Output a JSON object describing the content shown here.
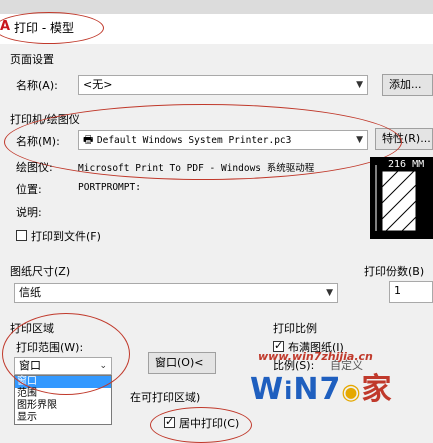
{
  "window": {
    "title": "打印 - 模型"
  },
  "page_setup": {
    "section": "页面设置",
    "name_label": "名称(A):",
    "name_value": "<无>",
    "add_button": "添加..."
  },
  "printer": {
    "section": "打印机/绘图仪",
    "name_label": "名称(M):",
    "name_value": "Default Windows System Printer.pc3",
    "properties_button": "特性(R)...",
    "plotter_label": "绘图仪:",
    "plotter_value": "Microsoft Print To PDF - Windows 系统驱动程",
    "location_label": "位置:",
    "location_value": "PORTPROMPT:",
    "description_label": "说明:",
    "print_to_file": "打印到文件(F)",
    "preview_dimension": "216 MM"
  },
  "paper_size": {
    "section": "图纸尺寸(Z)",
    "value": "信纸"
  },
  "copies": {
    "label": "打印份数(B)",
    "value": "1"
  },
  "print_area": {
    "section": "打印区域",
    "range_label": "打印范围(W):",
    "range_value": "窗口",
    "options": [
      "窗口",
      "范围",
      "图形界限",
      "显示"
    ],
    "window_button": "窗口(O)<",
    "offset_label_partial": "在可打印区域)"
  },
  "scale": {
    "section": "打印比例",
    "fit_paper": "布满图纸(I)",
    "scale_label": "比例(S):",
    "scale_value": "自定义"
  },
  "offset": {
    "center_print": "居中打印(C)"
  },
  "watermark": {
    "url": "www.win7zhijia.cn",
    "brand_left": "W",
    "brand_mid": "N",
    "brand_num": "7",
    "brand_zh": "家"
  },
  "colors": {
    "annotation_red": "#c0392b",
    "title_icon": "#c8161d",
    "watermark_blue": "#1f5fbf"
  }
}
